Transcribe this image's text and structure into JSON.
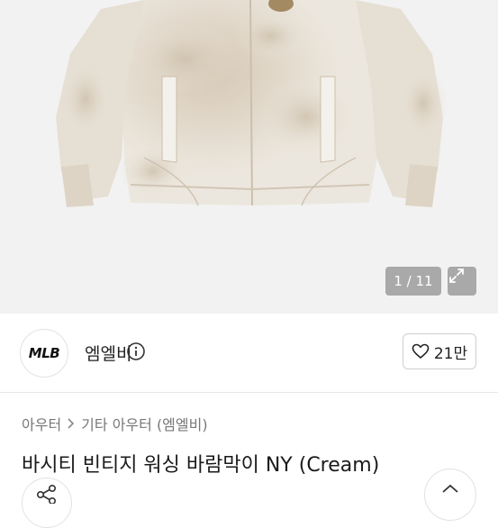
{
  "gallery": {
    "image_alt_name": "washed-windbreaker-jacket",
    "counter": "1 / 11",
    "expand_icon": "expand-icon"
  },
  "seller": {
    "logo_text": "MLB",
    "name": "엠엘비",
    "info_icon": "info-icon",
    "like_count": "21만",
    "like_icon": "heart-icon"
  },
  "product": {
    "breadcrumb": [
      "아우터",
      "기타 아우터 (엠엘비)"
    ],
    "breadcrumb_separator_icon": "chevron-right-icon",
    "title": "바시티 빈티지 워싱 바람막이 NY (Cream)"
  },
  "actions": {
    "share_icon": "share-icon",
    "floating_icon": "chevron-up-icon"
  },
  "colors": {
    "jacket_cream": "#e9e3d8",
    "jacket_wash": "#d5c8b6",
    "overlay": "#6e6e6e",
    "border": "#e2e2e2"
  }
}
